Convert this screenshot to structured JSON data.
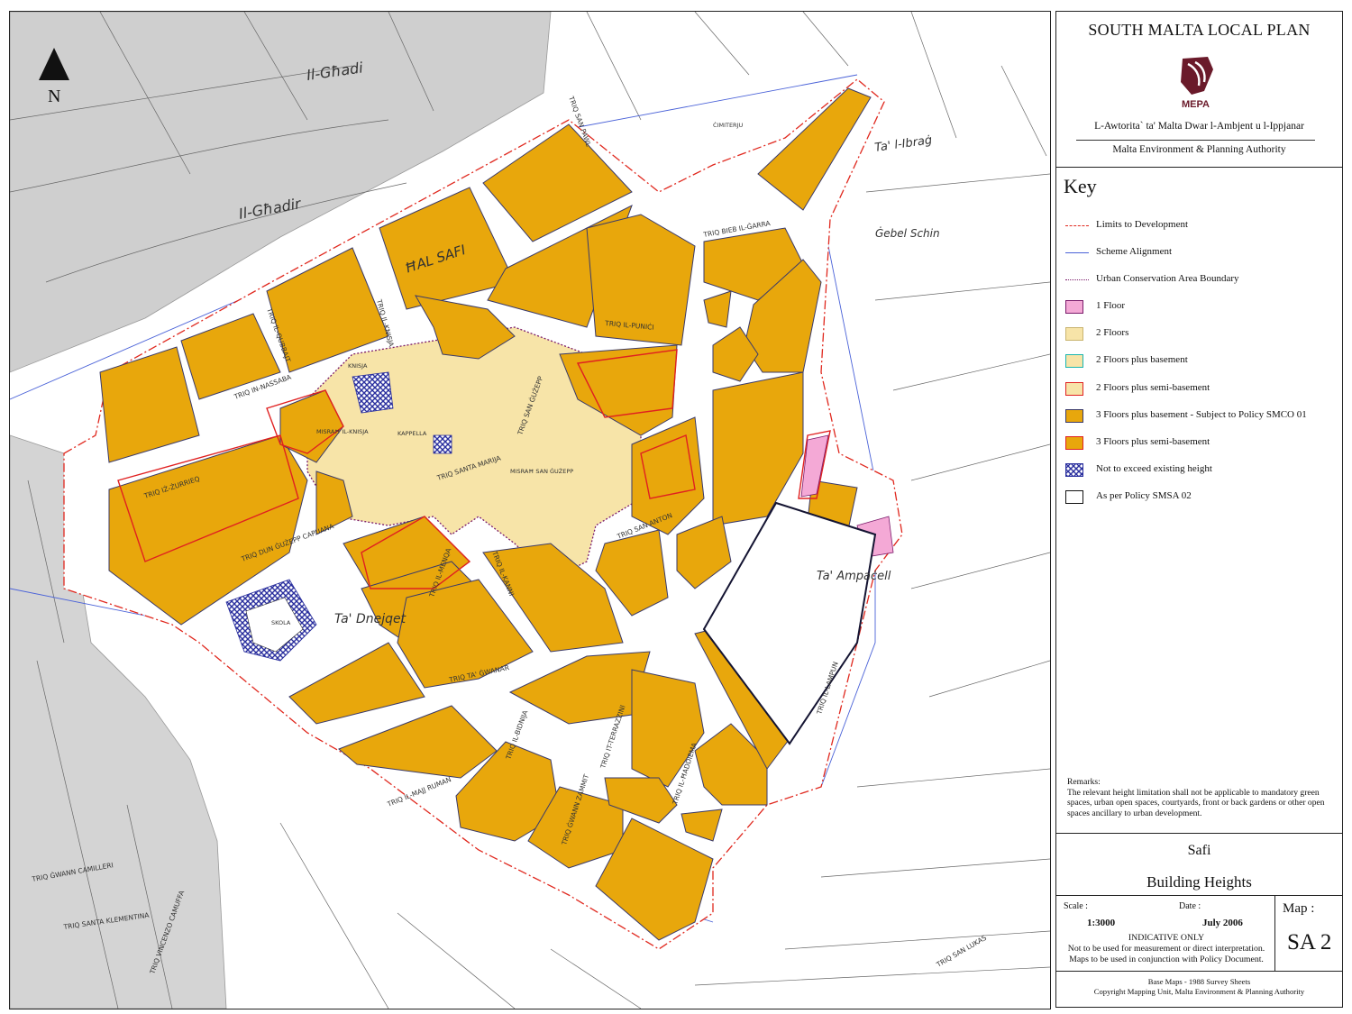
{
  "header": {
    "plan_title": "SOUTH MALTA LOCAL PLAN",
    "logo_text": "MEPA",
    "authority_maltese": "L-Awtorita` ta' Malta Dwar l-Ambjent u l-Ippjanar",
    "authority_english": "Malta Environment & Planning Authority"
  },
  "key": {
    "title": "Key",
    "items": [
      {
        "label": "Limits to Development",
        "symbol": "dash-dot-line",
        "color": "#e0281e"
      },
      {
        "label": "Scheme Alignment",
        "symbol": "line",
        "color": "#4a62d8"
      },
      {
        "label": "Urban Conservation Area Boundary",
        "symbol": "dotted-line",
        "color": "#7a1a6a"
      },
      {
        "label": "1 Floor",
        "symbol": "swatch",
        "color": "#f4a9d6"
      },
      {
        "label": "2 Floors",
        "symbol": "swatch",
        "color": "#f7e4a8"
      },
      {
        "label": "2 Floors plus basement",
        "symbol": "swatch-outline",
        "color": "#f7e4a8",
        "outline": "#19b6b0"
      },
      {
        "label": "2 Floors plus semi-basement",
        "symbol": "swatch-outline",
        "color": "#f7e4a8",
        "outline": "#e02020"
      },
      {
        "label": "3 Floors plus basement - Subject to Policy SMCO 01",
        "symbol": "swatch",
        "color": "#e8a70c"
      },
      {
        "label": "3 Floors plus semi-basement",
        "symbol": "swatch-outline",
        "color": "#e8a70c",
        "outline": "#e02020"
      },
      {
        "label": "Not to exceed existing height",
        "symbol": "crosshatch",
        "color": "#2a2f9e"
      },
      {
        "label": "As per Policy SMSA 02",
        "symbol": "swatch-outline",
        "color": "#ffffff",
        "outline": "#111111"
      }
    ]
  },
  "remarks": {
    "title": "Remarks:",
    "text": "The relevant height limitation shall not be applicable to mandatory green spaces, urban open spaces, courtyards, front or back gardens or other open spaces ancillary to urban development."
  },
  "title_block": {
    "place": "Safi",
    "subject": "Building Heights"
  },
  "info": {
    "scale_label": "Scale :",
    "scale_value": "1:3000",
    "date_label": "Date :",
    "date_value": "July 2006",
    "indicative": "INDICATIVE ONLY",
    "note_1": "Not to be used for measurement or direct interpretation.",
    "note_2": "Maps to be used in conjunction with Policy Document.",
    "map_label": "Map :",
    "map_number": "SA 2"
  },
  "credits": {
    "line_1": "Base Maps - 1988 Survey Sheets",
    "line_2": "Copyright Mapping Unit, Malta Environment & Planning Authority"
  },
  "map": {
    "north_label": "N",
    "places": [
      "Il-Għadi",
      "Il-Għadir",
      "ĦAL SAFI",
      "Ta' l-Ibraġ",
      "Ġebel Schin",
      "Ta' Ampaċell",
      "Ta' Dnejqet"
    ],
    "streets": [
      "TRIQ SAN PAWL",
      "TRIQ IL-PUNIĊI",
      "TRIQ SAN ĠUŻEPP",
      "TRIQ SANTA MARIJA",
      "TRIQ IŻ-ŻURRIEQ",
      "TRIQ DUN ĠUŻEPP CAPUANA",
      "TRIQ TA' ĠWANAR",
      "TRIQ IL-BIDNIJA",
      "TRIQ IL-MAJJ RUMAN",
      "TRIQ ĠWANN ZAMMIT",
      "TRIQ SAN ANTON",
      "TRIQ IL-KNISJA",
      "TRIQ BIEB IL-ĠARRA",
      "TRIQ IN-NASSABA",
      "TRIQ IL-QUBBAJT",
      "TRIQ IL-MENQA",
      "TRIQ IL-KANNI",
      "TRIQ IL-LAMPUN",
      "TRIQ SAN LUKAS",
      "TRIQ ĠWANN CAMILLERI",
      "TRIQ SANTA KLEMENTINA",
      "TRIQ VINCENZO CAMUFFA",
      "TRIQ IT-TERRAZZINI",
      "TRIQ IL-ĦADDIEMA"
    ],
    "features": [
      "MISRAĦ IL-KNISJA",
      "MISRAĦ SAN ĠUŻEPP",
      "KAPPELLA",
      "SKOLA",
      "KNISJA",
      "ĊIMITERJU"
    ]
  }
}
